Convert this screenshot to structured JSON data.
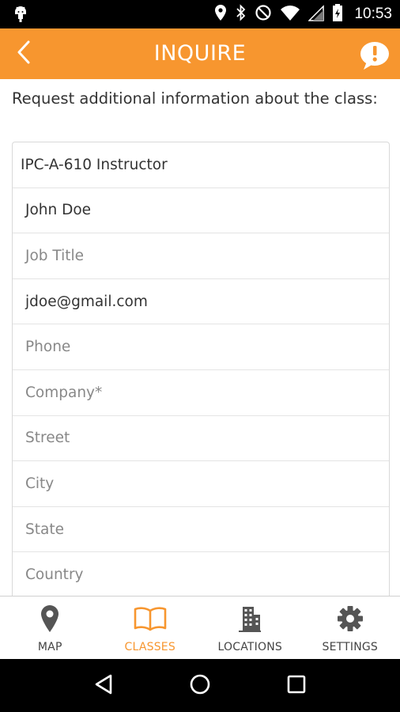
{
  "status_bar": {
    "time": "10:53",
    "icons": [
      "android-debug-icon",
      "location-icon",
      "bluetooth-icon",
      "do-not-disturb-icon",
      "wifi-icon",
      "signal-icon",
      "battery-icon"
    ]
  },
  "app_bar": {
    "title": "INQUIRE",
    "back_icon": "chevron-left-icon",
    "action_icon": "alert-bubble-icon",
    "color": "#f7962f"
  },
  "main": {
    "intro_text": "Request additional information about the class:",
    "fields": [
      {
        "name": "class",
        "value": "IPC-A-610 Instructor",
        "placeholder": ""
      },
      {
        "name": "name",
        "value": "John Doe",
        "placeholder": ""
      },
      {
        "name": "job_title",
        "value": "",
        "placeholder": "Job Title"
      },
      {
        "name": "email",
        "value": "jdoe@gmail.com",
        "placeholder": ""
      },
      {
        "name": "phone",
        "value": "",
        "placeholder": "Phone"
      },
      {
        "name": "company",
        "value": "",
        "placeholder": "Company*"
      },
      {
        "name": "street",
        "value": "",
        "placeholder": "Street"
      },
      {
        "name": "city",
        "value": "",
        "placeholder": "City"
      },
      {
        "name": "state",
        "value": "",
        "placeholder": "State"
      },
      {
        "name": "country",
        "value": "",
        "placeholder": "Country"
      }
    ]
  },
  "bottom_nav": {
    "active": "classes",
    "active_color": "#f7962f",
    "items": [
      {
        "id": "map",
        "label": "MAP",
        "icon": "map-pin-icon"
      },
      {
        "id": "classes",
        "label": "CLASSES",
        "icon": "open-book-icon"
      },
      {
        "id": "locations",
        "label": "LOCATIONS",
        "icon": "building-icon"
      },
      {
        "id": "settings",
        "label": "SETTINGS",
        "icon": "gear-icon"
      }
    ]
  },
  "system_nav": {
    "icons": [
      "back-triangle-icon",
      "home-circle-icon",
      "recents-square-icon"
    ]
  }
}
